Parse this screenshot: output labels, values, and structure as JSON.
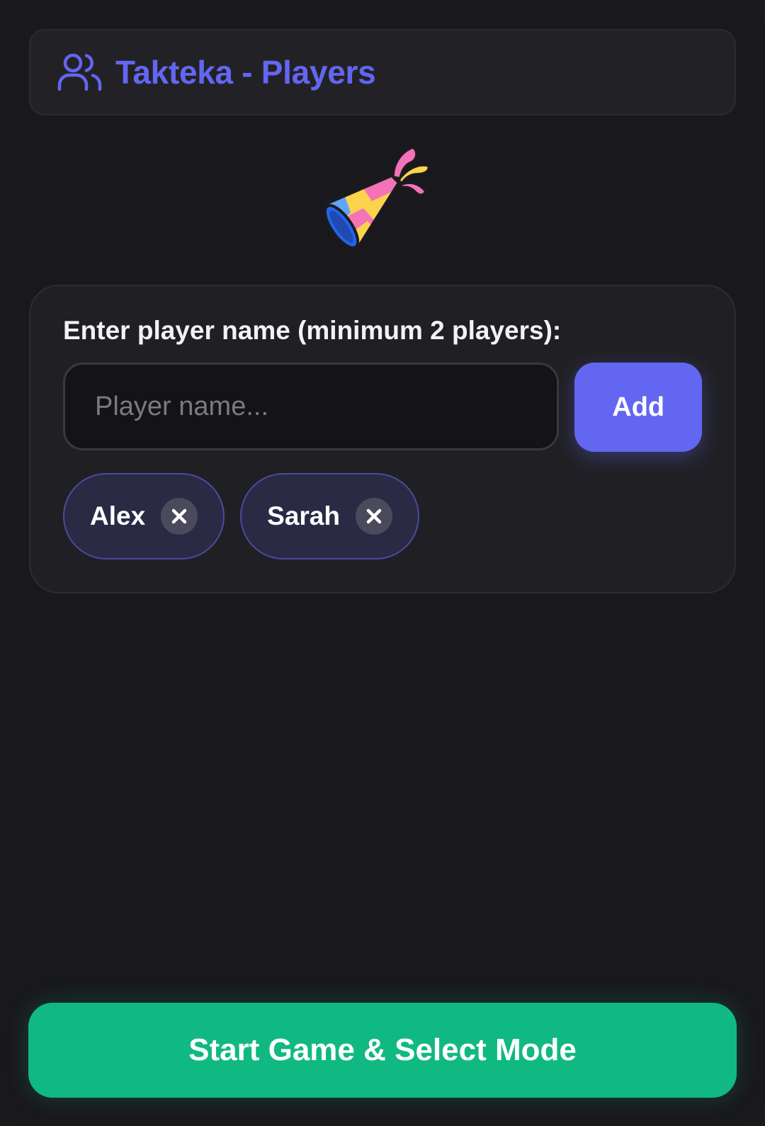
{
  "header": {
    "title": "Takteka - Players",
    "icon": "users-icon"
  },
  "hero": {
    "icon": "party-popper-icon"
  },
  "players_card": {
    "label": "Enter player name (minimum 2 players):",
    "input": {
      "value": "",
      "placeholder": "Player name..."
    },
    "add_label": "Add",
    "remove_symbol": "✕",
    "players": [
      {
        "name": "Alex"
      },
      {
        "name": "Sarah"
      }
    ]
  },
  "start_button": {
    "label": "Start Game & Select Mode"
  },
  "colors": {
    "accent": "#6366f1",
    "success": "#10b981",
    "background": "#19191d"
  }
}
